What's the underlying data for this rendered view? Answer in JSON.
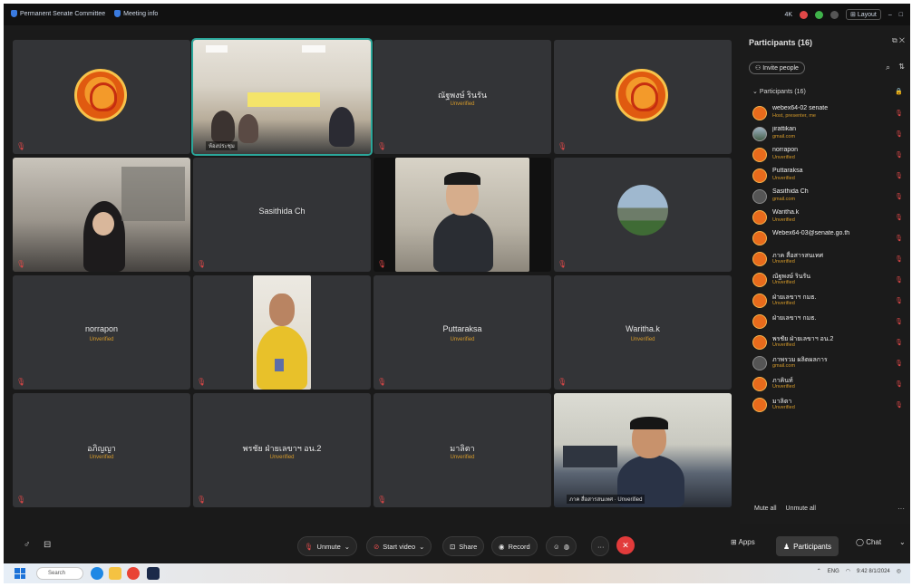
{
  "topbar": {
    "title": "Permanent Senate Committee",
    "meeting_info": "Meeting info",
    "vid_quality": "4K",
    "layout": "Layout"
  },
  "tiles": [
    {
      "kind": "emblem",
      "name": "",
      "status": ""
    },
    {
      "kind": "video-room",
      "name": "",
      "status": "",
      "caption": "ห้องประชุม"
    },
    {
      "kind": "name",
      "name": "ณัฐพงษ์ รินรัน",
      "status": "Unverified"
    },
    {
      "kind": "emblem",
      "name": "",
      "status": ""
    },
    {
      "kind": "video-woman",
      "name": "",
      "status": ""
    },
    {
      "kind": "name",
      "name": "Sasithida Ch",
      "status": ""
    },
    {
      "kind": "video-man",
      "name": "",
      "status": ""
    },
    {
      "kind": "landscape",
      "name": "",
      "status": ""
    },
    {
      "kind": "name",
      "name": "norrapon",
      "status": "Unverified"
    },
    {
      "kind": "video-yellow",
      "name": "",
      "status": ""
    },
    {
      "kind": "name",
      "name": "Puttaraksa",
      "status": "Unverified"
    },
    {
      "kind": "name",
      "name": "Waritha.k",
      "status": "Unverified"
    },
    {
      "kind": "name",
      "name": "อภิญญา",
      "status": "Unverified"
    },
    {
      "kind": "name",
      "name": "พรชัย ฝ่ายเลขาฯ อน.2",
      "status": "Unverified"
    },
    {
      "kind": "name",
      "name": "มาลิตา",
      "status": "Unverified"
    },
    {
      "kind": "video-office",
      "name": "",
      "status": "",
      "caption": "ภาค สื่อสารสนเทศ · Unverified"
    }
  ],
  "panel": {
    "title": "Participants (16)",
    "invite": "Invite people",
    "section": "Participants (16)",
    "participants": [
      {
        "name": "webex64-02 senate",
        "sub": "Host, presenter, me",
        "avatar": "orange"
      },
      {
        "name": "jirattikan",
        "sub": "gmail.com",
        "avatar": "photo"
      },
      {
        "name": "norrapon",
        "sub": "Unverified",
        "avatar": "orange"
      },
      {
        "name": "Puttaraksa",
        "sub": "Unverified",
        "avatar": "orange"
      },
      {
        "name": "Sasithida Ch",
        "sub": "gmail.com",
        "avatar": "grey"
      },
      {
        "name": "Waritha.k",
        "sub": "Unverified",
        "avatar": "orange"
      },
      {
        "name": "Webex64-03@senate.go.th",
        "sub": "",
        "avatar": "orange"
      },
      {
        "name": "ภาค สื่อสารสนเทศ",
        "sub": "Unverified",
        "avatar": "orange"
      },
      {
        "name": "ณัฐพงษ์ รินรัน",
        "sub": "Unverified",
        "avatar": "orange"
      },
      {
        "name": "ฝ่ายเลขาฯ กมธ.",
        "sub": "Unverified",
        "avatar": "orange"
      },
      {
        "name": "ฝ่ายเลขาฯ กมธ.",
        "sub": "",
        "avatar": "orange"
      },
      {
        "name": "พรชัย ฝ่ายเลขาฯ อน.2",
        "sub": "Unverified",
        "avatar": "orange"
      },
      {
        "name": "ภาพรวม ผลิตผลการ",
        "sub": "gmail.com",
        "avatar": "grey"
      },
      {
        "name": "ภาคินท์",
        "sub": "Unverified",
        "avatar": "orange"
      },
      {
        "name": "มาลิตา",
        "sub": "Unverified",
        "avatar": "orange"
      }
    ],
    "mute_all": "Mute all",
    "unmute_all": "Unmute all"
  },
  "toolbar": {
    "unmute": "Unmute",
    "start_video": "Start video",
    "share": "Share",
    "record": "Record",
    "apps": "Apps",
    "participants": "Participants",
    "chat": "Chat"
  },
  "taskbar": {
    "search": "Search",
    "lang": "ENG",
    "time": "9:42",
    "date": "8/1/2024"
  },
  "colors": {
    "unverified": "#d59a2a",
    "muted": "#e04848",
    "active_speaker": "#2ba69a",
    "leave": "#e23b3b"
  }
}
